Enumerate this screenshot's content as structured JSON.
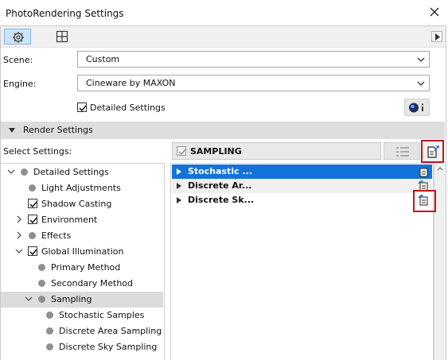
{
  "window": {
    "title": "PhotoRendering Settings"
  },
  "form": {
    "scene_label": "Scene:",
    "scene_value": "Custom",
    "engine_label": "Engine:",
    "engine_value": "Cineware by MAXON",
    "detailed_settings_label": "Detailed Settings",
    "detailed_settings_checked": true
  },
  "section": {
    "title": "Render Settings"
  },
  "select_settings": {
    "label": "Select Settings:",
    "field_value": "SAMPLING"
  },
  "tree": [
    {
      "label": "Detailed Settings",
      "level": 0,
      "expanded": true,
      "checkbox": false
    },
    {
      "label": "Light Adjustments",
      "level": 1,
      "checkbox": false
    },
    {
      "label": "Shadow Casting",
      "level": 1,
      "checkbox": true
    },
    {
      "label": "Environment",
      "level": 1,
      "checkbox": true,
      "expandable": true
    },
    {
      "label": "Effects",
      "level": 1,
      "checkbox": false,
      "expandable": true
    },
    {
      "label": "Global Illumination",
      "level": 1,
      "checkbox": true,
      "expanded": true
    },
    {
      "label": "Primary Method",
      "level": 2,
      "checkbox": false
    },
    {
      "label": "Secondary Method",
      "level": 2,
      "checkbox": false
    },
    {
      "label": "Sampling",
      "level": 2,
      "checkbox": false,
      "expanded": true,
      "selected": true
    },
    {
      "label": "Stochastic Samples",
      "level": 3,
      "checkbox": false
    },
    {
      "label": "Discrete Area Sampling",
      "level": 3,
      "checkbox": false
    },
    {
      "label": "Discrete Sky Sampling",
      "level": 3,
      "checkbox": false
    }
  ],
  "settings_list": [
    {
      "label": "Stochastic ...",
      "selected": true
    },
    {
      "label": "Discrete Ar...",
      "selected": false
    },
    {
      "label": "Discrete Sk...",
      "selected": false
    }
  ],
  "colors": {
    "selection_blue": "#1473d8",
    "highlight_red": "#c0181c",
    "toolbar_active": "#cde3f7"
  },
  "icons": {
    "toolbar": [
      "gear-icon",
      "grid-icon"
    ],
    "info": "cineware-info-icon",
    "list_view": "list-view-icon",
    "export": "export-settings-icon",
    "row_actions": "settings-action-icon"
  }
}
